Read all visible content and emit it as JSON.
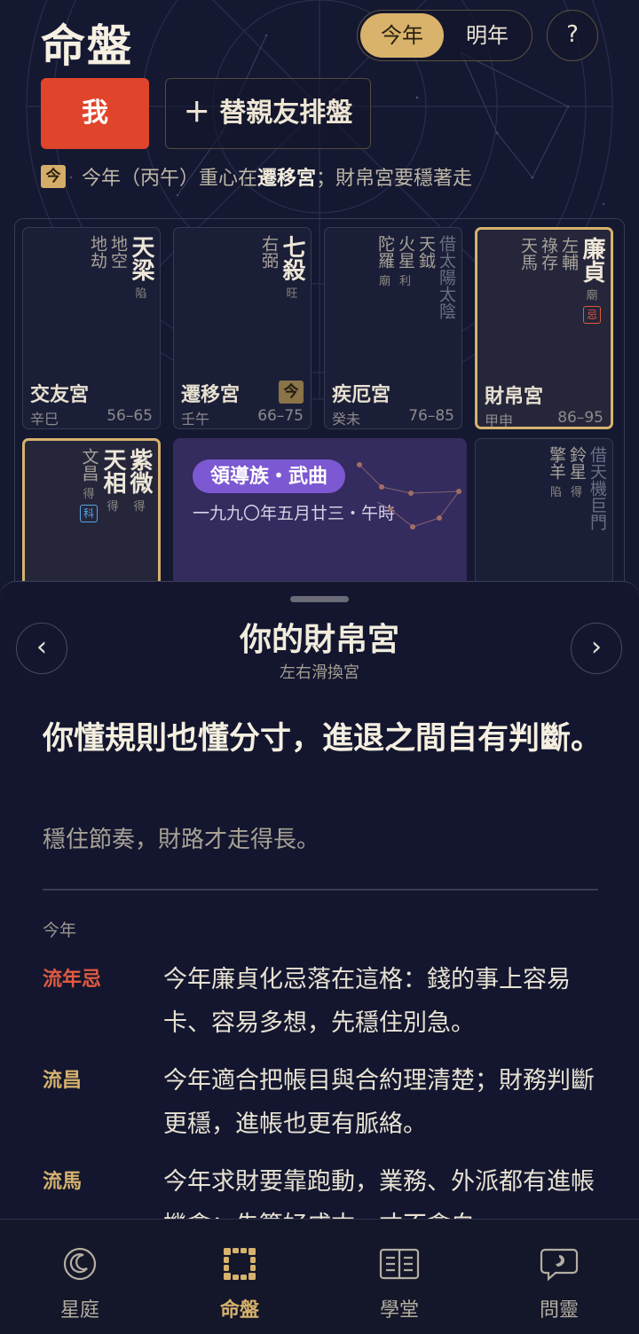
{
  "header": {
    "title": "命盤",
    "year_options": [
      "今年",
      "明年"
    ],
    "year_selected": "今年",
    "help_label": "?",
    "me_label": "我",
    "friend_label": "＋ 替親友排盤"
  },
  "focus": {
    "badge": "今",
    "prefix": "今年（丙午）重心在",
    "palace": "遷移宮",
    "suffix": "；財帛宮要穩著走"
  },
  "palaces": [
    {
      "name": "交友宮",
      "stem": "辛巳",
      "ages": "56–65",
      "stars": [
        {
          "name": "天梁",
          "type": "major",
          "level": "陷"
        },
        {
          "name": "地空",
          "type": "minor",
          "level": ""
        },
        {
          "name": "地劫",
          "type": "minor",
          "level": ""
        }
      ]
    },
    {
      "name": "遷移宮",
      "stem": "壬午",
      "ages": "66–75",
      "badge": "今",
      "stars": [
        {
          "name": "七殺",
          "type": "major",
          "level": "旺"
        },
        {
          "name": "右弼",
          "type": "minor",
          "level": ""
        }
      ]
    },
    {
      "name": "疾厄宮",
      "stem": "癸未",
      "ages": "76–85",
      "stars": [
        {
          "name": "借太陽太陰",
          "type": "borrow",
          "level": ""
        },
        {
          "name": "天鉞",
          "type": "minor",
          "level": ""
        },
        {
          "name": "火星",
          "type": "minor",
          "level": "利"
        },
        {
          "name": "陀羅",
          "type": "minor",
          "level": "廟"
        }
      ]
    },
    {
      "name": "財帛宮",
      "stem": "甲申",
      "ages": "86–95",
      "highlight": true,
      "stars": [
        {
          "name": "廉貞",
          "type": "major",
          "level": "廟",
          "hua": "忌",
          "hua_type": "ji"
        },
        {
          "name": "左輔",
          "type": "minor",
          "level": ""
        },
        {
          "name": "祿存",
          "type": "minor",
          "level": ""
        },
        {
          "name": "天馬",
          "type": "minor",
          "level": ""
        }
      ]
    },
    {
      "name": "",
      "stem": "",
      "ages": "",
      "highlight": true,
      "stars": [
        {
          "name": "紫微",
          "type": "major",
          "level": "得"
        },
        {
          "name": "天相",
          "type": "major",
          "level": "得"
        },
        {
          "name": "文昌",
          "type": "minor",
          "level": "得",
          "hua": "科",
          "hua_type": "ke"
        }
      ]
    },
    {
      "name": "",
      "stem": "",
      "ages": "",
      "stars": [
        {
          "name": "借天機巨門",
          "type": "borrow",
          "level": ""
        },
        {
          "name": "鈴星",
          "type": "minor",
          "level": "得"
        },
        {
          "name": "擎羊",
          "type": "minor",
          "level": "陷"
        }
      ]
    }
  ],
  "center": {
    "tag": "領導族・武曲",
    "date": "一九九〇年五月廿三・午時"
  },
  "sheet": {
    "title": "你的財帛宮",
    "subtitle": "左右滑換宮",
    "prev": "‹",
    "next": "›",
    "headline": "你懂規則也懂分寸，進退之間自有判斷。",
    "subline": "穩住節奏，財路才走得長。",
    "year_label": "今年",
    "rows": [
      {
        "label": "流年忌",
        "color": "#e05a42",
        "text": "今年廉貞化忌落在這格：錢的事上容易卡、容易多想，先穩住別急。"
      },
      {
        "label": "流昌",
        "color": "#d6b26d",
        "text": "今年適合把帳目與合約理清楚；財務判斷更穩，進帳也更有脈絡。"
      },
      {
        "label": "流馬",
        "color": "#d6b26d",
        "text": "今年求財要靠跑動，業務、外派都有進帳機會；先算好成本，才不會白"
      }
    ]
  },
  "nav": [
    {
      "label": "星庭",
      "icon": "moon-icon"
    },
    {
      "label": "命盤",
      "icon": "chart-grid-icon",
      "active": true
    },
    {
      "label": "學堂",
      "icon": "book-icon"
    },
    {
      "label": "問靈",
      "icon": "chat-icon"
    }
  ]
}
